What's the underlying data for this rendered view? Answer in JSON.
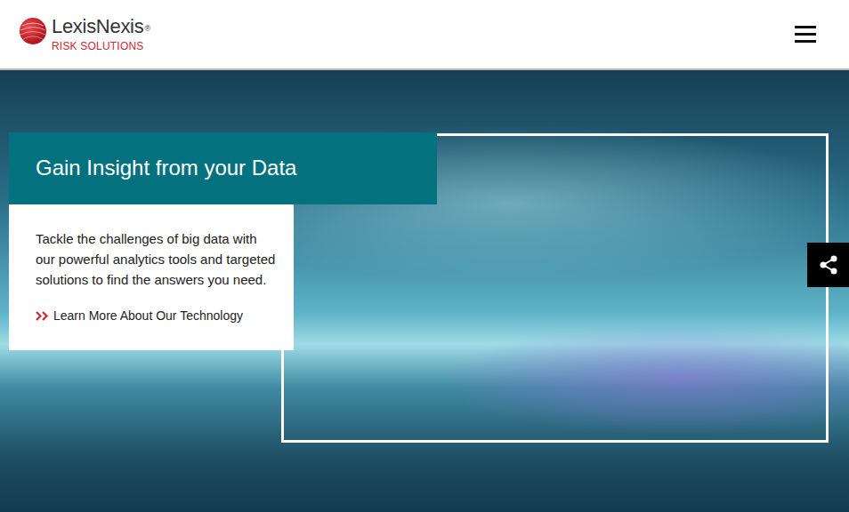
{
  "header": {
    "logo": {
      "name": "LexisNexis",
      "mark": "®",
      "tagline": "RISK SOLUTIONS"
    }
  },
  "hero": {
    "title": "Gain Insight from your Data",
    "description": "Tackle the challenges of big data with our powerful analytics tools and targeted solutions to find the answers you need.",
    "link": {
      "label": "Learn More About Our Technology"
    }
  }
}
